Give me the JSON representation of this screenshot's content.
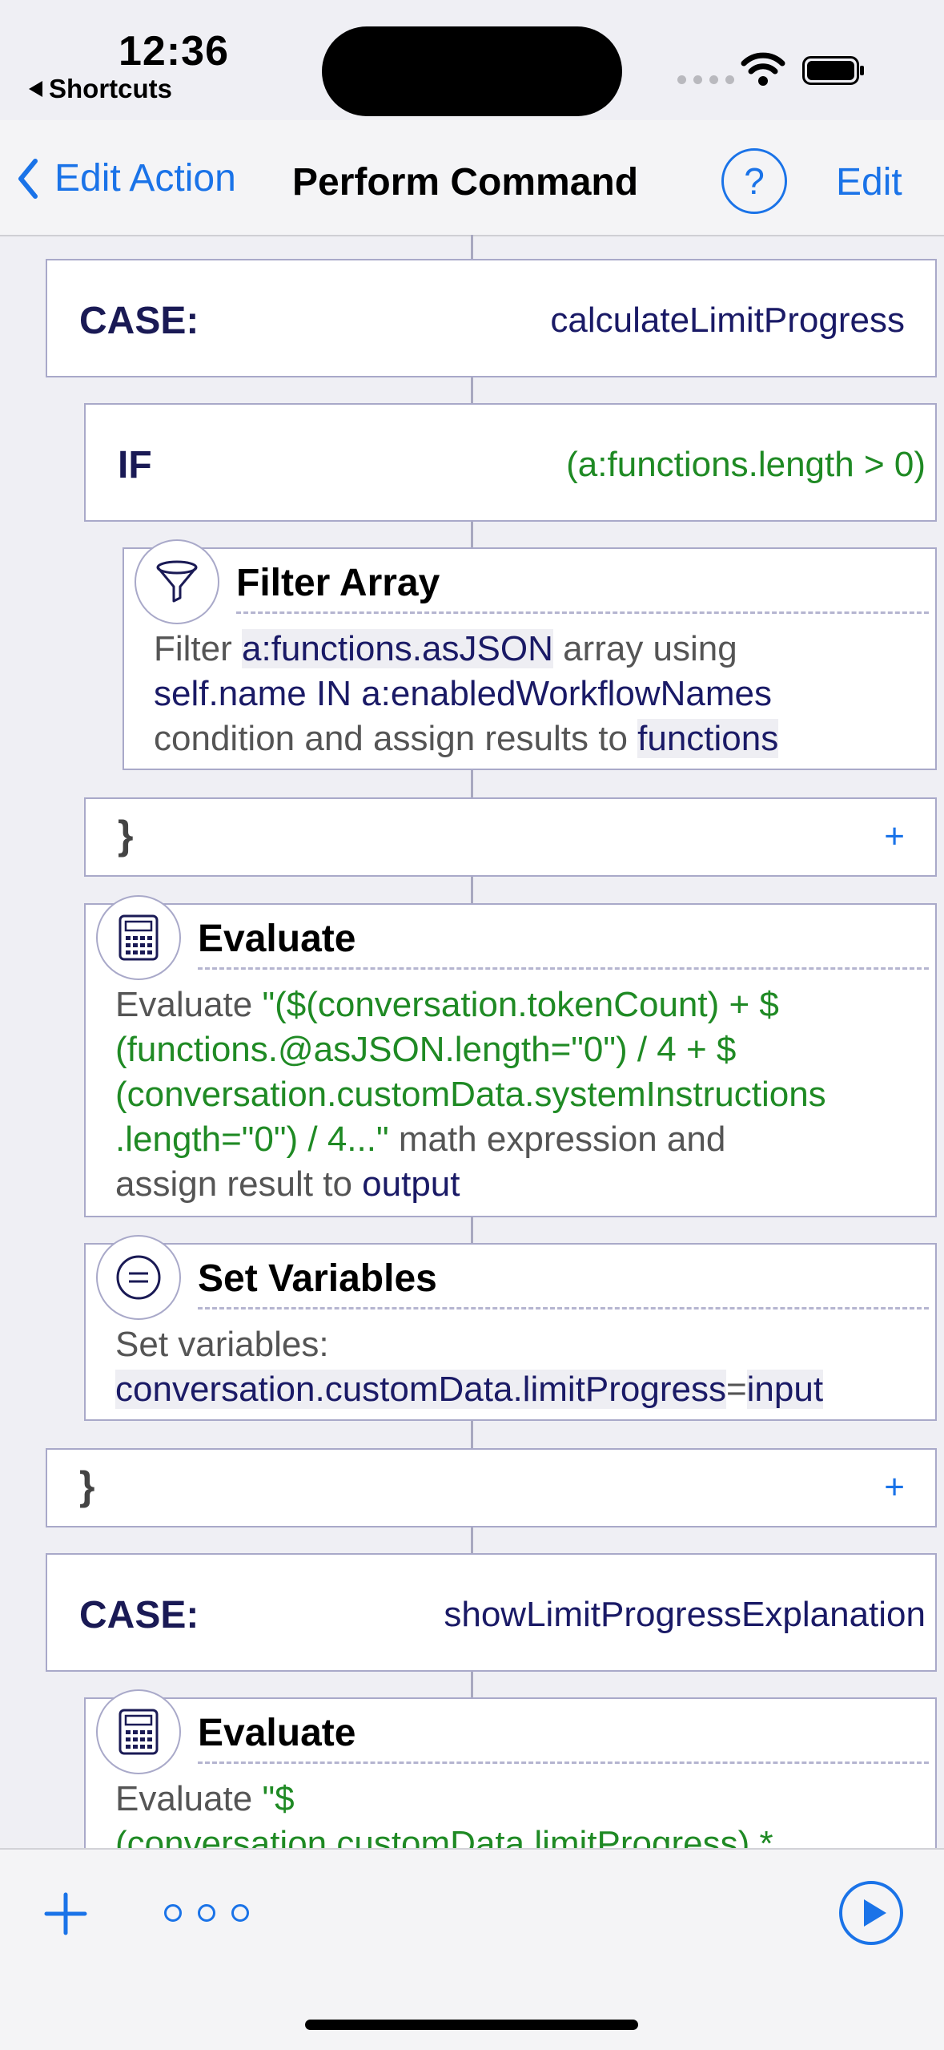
{
  "status_bar": {
    "time": "12:36",
    "back_app": "Shortcuts"
  },
  "nav": {
    "back_label": "Edit Action",
    "title": "Perform Command",
    "help": "?",
    "edit_label": "Edit"
  },
  "blocks": {
    "case1": {
      "label": "CASE:",
      "value": "calculateLimitProgress"
    },
    "if1": {
      "label": "IF",
      "condition": "(a:functions.length > 0)"
    },
    "filter": {
      "title": "Filter Array",
      "t1": "Filter ",
      "v1": "a:functions.asJSON",
      "t2": " array using",
      "v2": "self.name IN a:enabledWorkflowNames",
      "t3": "condition and assign results to ",
      "v3": "functions"
    },
    "close_if": {
      "brace": "}",
      "plus": "+"
    },
    "evaluate1": {
      "title": "Evaluate",
      "t1": "Evaluate ",
      "expr1": "\"($(conversation.tokenCount) + $",
      "expr2": "(functions.@asJSON.length=\"0\") / 4 + $",
      "expr3": "(conversation.customData.systemInstructions",
      "expr4": ".length=\"0\") / 4...\"",
      "t2": " math expression and",
      "t3": "assign result to ",
      "v": "output"
    },
    "setvars": {
      "title": "Set Variables",
      "t1": "Set variables:",
      "var": "conversation.customData.limitProgress",
      "eq": "=",
      "val": "input"
    },
    "close_case": {
      "brace": "}",
      "plus": "+"
    },
    "case2": {
      "label": "CASE:",
      "value": "showLimitProgressExplanation"
    },
    "evaluate2": {
      "title": "Evaluate",
      "t1": "Evaluate ",
      "expr1": "\"$",
      "expr2": "(conversation.customData.limitProgress) *"
    }
  },
  "toolbar": {
    "add": "+",
    "more": "more",
    "run": "play"
  },
  "colors": {
    "accent": "#1a73e8",
    "variable": "#1a1a66",
    "expression": "#1f8a24",
    "border": "#a9a9c9"
  }
}
